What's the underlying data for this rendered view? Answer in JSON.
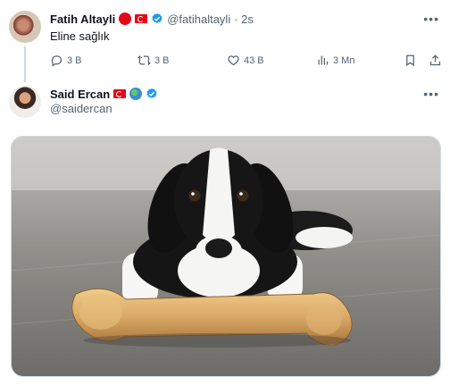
{
  "reply_post": {
    "author_name": "Fatih Altayli",
    "handle": "@fatihaltayli",
    "time": "· 2s",
    "text": "Eline sağlık",
    "stats": {
      "replies": "3 B",
      "reposts": "3 B",
      "likes": "43 B",
      "views": "3 Mn"
    }
  },
  "quoted_post": {
    "author_name": "Said Ercan",
    "handle": "@saidercan"
  },
  "icons": [
    "red-dot-icon",
    "turkey-flag-icon",
    "verified-icon",
    "globe-icon",
    "reply-icon",
    "repost-icon",
    "like-icon",
    "views-icon",
    "bookmark-icon",
    "share-icon",
    "more-icon"
  ],
  "colors": {
    "verified": "#1d9bf0",
    "flag_red": "#e30a17",
    "muted": "#536471"
  }
}
